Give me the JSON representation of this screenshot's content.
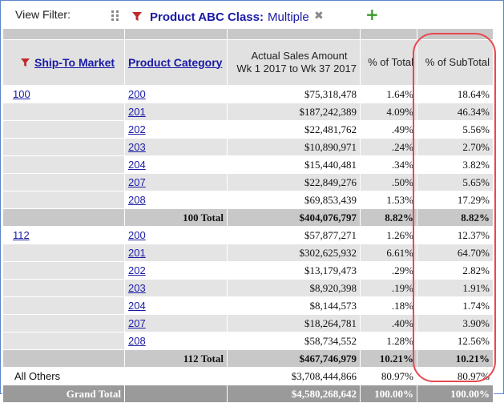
{
  "filter_bar": {
    "label": "View Filter:",
    "filter_name": "Product ABC Class:",
    "filter_value": "Multiple",
    "remove_glyph": "✖",
    "add_glyph": "+",
    "icons": [
      "drag-handle-icon",
      "filter-funnel-icon",
      "remove-filter-icon",
      "add-filter-icon"
    ]
  },
  "table": {
    "headers": {
      "market": "Ship-To Market",
      "category": "Product Category",
      "sales_line1": "Actual Sales Amount",
      "sales_line2": "Wk 1 2017 to Wk 37 2017",
      "pct_total": "% of Total",
      "pct_subtotal": "% of SubTotal"
    },
    "groups": [
      {
        "market": "100",
        "rows": [
          {
            "category": "200",
            "sales": "$75,318,478",
            "pct_total": "1.64%",
            "pct_subtotal": "18.64%"
          },
          {
            "category": "201",
            "sales": "$187,242,389",
            "pct_total": "4.09%",
            "pct_subtotal": "46.34%"
          },
          {
            "category": "202",
            "sales": "$22,481,762",
            "pct_total": ".49%",
            "pct_subtotal": "5.56%"
          },
          {
            "category": "203",
            "sales": "$10,890,971",
            "pct_total": ".24%",
            "pct_subtotal": "2.70%"
          },
          {
            "category": "204",
            "sales": "$15,440,481",
            "pct_total": ".34%",
            "pct_subtotal": "3.82%"
          },
          {
            "category": "207",
            "sales": "$22,849,276",
            "pct_total": ".50%",
            "pct_subtotal": "5.65%"
          },
          {
            "category": "208",
            "sales": "$69,853,439",
            "pct_total": "1.53%",
            "pct_subtotal": "17.29%"
          }
        ],
        "total": {
          "label": "100 Total",
          "sales": "$404,076,797",
          "pct_total": "8.82%",
          "pct_subtotal": "8.82%"
        }
      },
      {
        "market": "112",
        "rows": [
          {
            "category": "200",
            "sales": "$57,877,271",
            "pct_total": "1.26%",
            "pct_subtotal": "12.37%"
          },
          {
            "category": "201",
            "sales": "$302,625,932",
            "pct_total": "6.61%",
            "pct_subtotal": "64.70%"
          },
          {
            "category": "202",
            "sales": "$13,179,473",
            "pct_total": ".29%",
            "pct_subtotal": "2.82%"
          },
          {
            "category": "203",
            "sales": "$8,920,398",
            "pct_total": ".19%",
            "pct_subtotal": "1.91%"
          },
          {
            "category": "204",
            "sales": "$8,144,573",
            "pct_total": ".18%",
            "pct_subtotal": "1.74%"
          },
          {
            "category": "207",
            "sales": "$18,264,781",
            "pct_total": ".40%",
            "pct_subtotal": "3.90%"
          },
          {
            "category": "208",
            "sales": "$58,734,552",
            "pct_total": "1.28%",
            "pct_subtotal": "12.56%"
          }
        ],
        "total": {
          "label": "112 Total",
          "sales": "$467,746,979",
          "pct_total": "10.21%",
          "pct_subtotal": "10.21%"
        }
      }
    ],
    "all_others": {
      "label": "All Others",
      "sales": "$3,708,444,866",
      "pct_total": "80.97%",
      "pct_subtotal": "80.97%"
    },
    "grand_total": {
      "label": "Grand Total",
      "sales": "$4,580,268,642",
      "pct_total": "100.00%",
      "pct_subtotal": "100.00%"
    }
  },
  "colors": {
    "link": "#1a1aa6",
    "funnel": "#c0282d",
    "highlight_ring": "#e8484f",
    "add_icon": "#3a9a2a",
    "frame_border": "#5b86c5"
  }
}
